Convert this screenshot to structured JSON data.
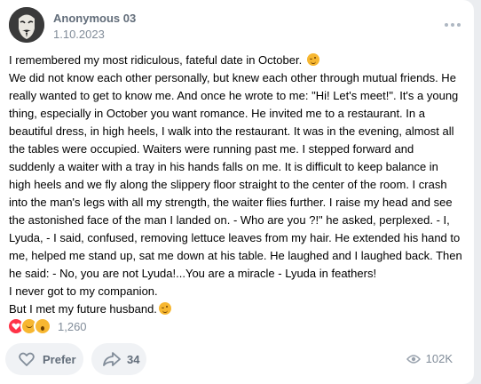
{
  "post": {
    "author": "Anonymous 03",
    "date": "1.10.2023",
    "lines": [
      "I remembered my most ridiculous, fateful date in October.",
      "We did not know each other personally, but knew each other through mutual friends. He",
      "really wanted to get to know me. And once he wrote to me: \"Hi! Let's meet!\". It's a young",
      "thing, especially in October you want romance. He invited me to a restaurant. In a",
      "beautiful dress, in high heels, I walk into the restaurant. It was in the evening, almost all",
      "the tables were occupied. Waiters were running past me. I stepped forward and",
      "suddenly a waiter with a tray in his hands falls on me. It is difficult to keep balance in",
      "high heels and we fly along the slippery floor straight to the center of the room. I crash",
      "into the man's legs with all my strength, the waiter flies further. I raise my head and see",
      "the astonished face of the man I landed on. - Who are you ?!\" he asked, perplexed. - I,",
      "Lyuda, - I said, confused, removing lettuce leaves from my hair. He extended his hand to",
      "me, helped me stand up, sat me down at his table. He laughed and I laughed back. Then",
      "he said: - No, you are not Lyuda!...You are a miracle - Lyuda in feathers!",
      "I never got to my companion.",
      "But I met my future husband."
    ],
    "emoji_after_lines": [
      0,
      14
    ]
  },
  "footer": {
    "reaction_icons": [
      "heart-icon",
      "laughing-emoji-icon",
      "surprised-emoji-icon"
    ],
    "reaction_count": "1,260",
    "prefer_label": "Prefer",
    "share_count": "34",
    "views": "102K"
  },
  "colors": {
    "accent_text": "#626d7a",
    "muted_text": "#818c99",
    "button_bg": "#f0f2f5",
    "heart": "#ff3347"
  }
}
